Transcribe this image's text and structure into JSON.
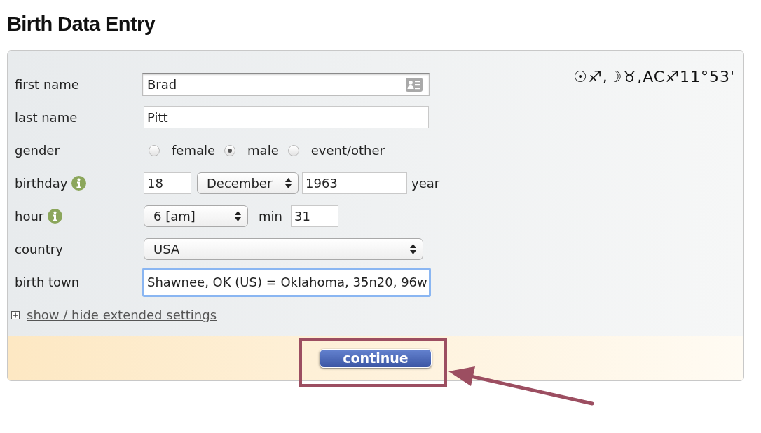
{
  "page_title": "Birth Data Entry",
  "form": {
    "chart_summary": "☉♐,☽♉,AC♐11°53'",
    "rows": [
      {
        "kind": "text",
        "label": "first name",
        "info_icon": false,
        "value": "Brad",
        "focused": false,
        "card_icon": true
      },
      {
        "kind": "text",
        "label": "last name",
        "info_icon": false,
        "value": "Pitt",
        "focused": false,
        "card_icon": false
      },
      {
        "kind": "radio",
        "label": "gender",
        "info_icon": false,
        "options": [
          {
            "label": "female",
            "selected": false
          },
          {
            "label": "male",
            "selected": true
          },
          {
            "label": "event/other",
            "selected": false
          }
        ]
      },
      {
        "kind": "date",
        "label": "birthday",
        "info_icon": true,
        "day": "18",
        "month": "December",
        "year": "1963",
        "year_label": "year"
      },
      {
        "kind": "time",
        "label": "hour",
        "info_icon": true,
        "hour": "6 [am]",
        "minute_label": "min",
        "minute": "31"
      },
      {
        "kind": "select",
        "label": "country",
        "info_icon": false,
        "value": "USA"
      },
      {
        "kind": "text",
        "label": "birth town",
        "info_icon": false,
        "value": "Shawnee, OK (US) = Oklahoma, 35n20, 96w",
        "focused": true,
        "card_icon": false
      }
    ],
    "extended_settings": {
      "label": "show / hide extended settings",
      "expanded": false
    },
    "submit_button": "continue"
  }
}
